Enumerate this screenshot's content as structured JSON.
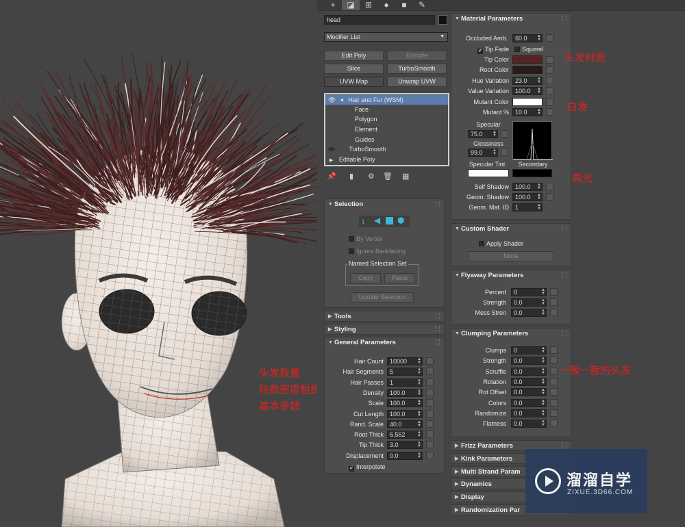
{
  "annotations": {
    "hair_count": "头发数量",
    "segments": "段数密度粗细等",
    "basic": "基本参数",
    "hair_material": "头发材质",
    "white_hair": "白发",
    "highlight": "高光",
    "clumps_note": "一簇一簇的头发"
  },
  "toolbar": {
    "tabs": [
      "create-icon",
      "modify-icon",
      "hierarchy-icon",
      "motion-icon",
      "display-icon",
      "utilities-icon"
    ]
  },
  "object": {
    "name": "head",
    "color": "#111111"
  },
  "modifier_list": "Modifier List",
  "modifier_buttons": [
    "Edit Poly",
    "Extrude",
    "Slice",
    "TurboSmooth",
    "UVW Map",
    "Unwrap UVW"
  ],
  "stack": {
    "items": [
      {
        "label": "Hair and Fur (WSM)"
      },
      {
        "label": "Face"
      },
      {
        "label": "Polygon"
      },
      {
        "label": "Element"
      },
      {
        "label": "Guides"
      },
      {
        "label": "TurboSmooth"
      },
      {
        "label": "Editable Poly"
      }
    ]
  },
  "selection": {
    "title": "Selection",
    "by_vertex": "By Vertex",
    "ignore_backfacing": "Ignore Backfacing",
    "named_set": "Named Selection Set",
    "copy": "Copy",
    "paste": "Paste",
    "update": "Update Selection"
  },
  "tools": {
    "title": "Tools"
  },
  "styling": {
    "title": "Styling"
  },
  "general": {
    "title": "General Parameters",
    "params": [
      {
        "label": "Hair Count",
        "value": "10000"
      },
      {
        "label": "Hair Segments",
        "value": "5"
      },
      {
        "label": "Hair Passes",
        "value": "1"
      },
      {
        "label": "Density",
        "value": "100.0"
      },
      {
        "label": "Scale",
        "value": "100.0"
      },
      {
        "label": "Cut Length",
        "value": "100.0"
      },
      {
        "label": "Rand. Scale",
        "value": "40.0"
      },
      {
        "label": "Root Thick",
        "value": "6.562"
      },
      {
        "label": "Tip Thick",
        "value": "3.0"
      },
      {
        "label": "Displacement",
        "value": "0.0"
      }
    ],
    "interpolate": "Interpolate"
  },
  "material": {
    "title": "Material Parameters",
    "occluded_label": "Occluded Amb.",
    "occluded_value": "60.0",
    "tip_fade": "Tip Fade",
    "squirrel": "Squirrel",
    "tip_color_label": "Tip Color",
    "tip_color": "#5a2323",
    "root_color_label": "Root Color",
    "root_color": "#2a1a1a",
    "hue_label": "Hue Variation",
    "hue_value": "23.0",
    "value_label": "Value Variation",
    "value_value": "100.0",
    "mutant_color_label": "Mutant Color",
    "mutant_color": "#ffffff",
    "mutant_pct_label": "Mutant %",
    "mutant_pct_value": "10.0",
    "specular_label": "Specular",
    "specular_value": "75.0",
    "gloss_label": "Glossiness",
    "gloss_value": "99.0",
    "spec_tint_label": "Specular Tint",
    "spec_tint": "#ffffff",
    "secondary_label": "Secondary",
    "secondary": "#000000",
    "self_shadow_label": "Self Shadow",
    "self_shadow_value": "100.0",
    "geom_shadow_label": "Geom. Shadow",
    "geom_shadow_value": "100.0",
    "geom_mat_label": "Geom. Mat. ID",
    "geom_mat_value": "1"
  },
  "custom_shader": {
    "title": "Custom Shader",
    "apply": "Apply Shader",
    "none": "None"
  },
  "flyaway": {
    "title": "Flyaway Parameters",
    "params": [
      {
        "label": "Percent",
        "value": "0"
      },
      {
        "label": "Strength",
        "value": "0.0"
      },
      {
        "label": "Mess Stren",
        "value": "0.0"
      }
    ]
  },
  "clumping": {
    "title": "Clumping Parameters",
    "params": [
      {
        "label": "Clumps",
        "value": "0"
      },
      {
        "label": "Strength",
        "value": "0.0"
      },
      {
        "label": "Scruffle",
        "value": "0.0"
      },
      {
        "label": "Rotation",
        "value": "0.0"
      },
      {
        "label": "Rot Offset",
        "value": "0.0"
      },
      {
        "label": "Colors",
        "value": "0.0"
      },
      {
        "label": "Randomize",
        "value": "0.0"
      },
      {
        "label": "Flatness",
        "value": "0.0"
      }
    ]
  },
  "collapsed": [
    "Frizz Parameters",
    "Kink Parameters",
    "Multi Strand Param",
    "Dynamics",
    "Display",
    "Randomization Par"
  ],
  "watermark": {
    "brand": "溜溜自学",
    "url": "ZIXUE.3D66.COM"
  }
}
